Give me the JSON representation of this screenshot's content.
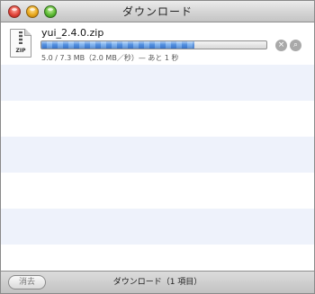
{
  "window": {
    "title": "ダウンロード"
  },
  "download": {
    "filename": "yui_2.4.0.zip",
    "file_icon_label": "ZIP",
    "progress_fraction": 0.68,
    "status": "5.0 / 7.3 MB（2.0 MB／秒）— あと 1 秒"
  },
  "icons": {
    "stop": "stop-icon",
    "reveal": "magnifier-icon",
    "file": "zip-file-icon"
  },
  "footer": {
    "clear_label": "消去",
    "status": "ダウンロード（1 項目）"
  },
  "colors": {
    "row_alt": "#eef2fb",
    "progress": "#4f8ddf"
  }
}
